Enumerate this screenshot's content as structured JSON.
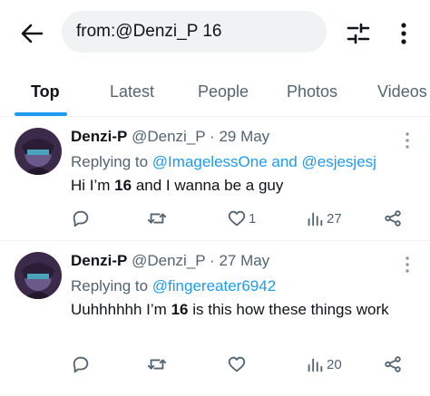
{
  "search": {
    "query": "from:@Denzi_P 16"
  },
  "tabs": [
    {
      "label": "Top"
    },
    {
      "label": "Latest"
    },
    {
      "label": "People"
    },
    {
      "label": "Photos"
    },
    {
      "label": "Videos"
    }
  ],
  "colors": {
    "accent": "#1d9bf0",
    "text": "#0f1419",
    "muted": "#536471",
    "divider": "#eff3f4"
  },
  "icons": [
    "back-arrow-icon",
    "filter-sliders-icon",
    "more-vertical-icon",
    "more-horizontal-icon",
    "reply-icon",
    "retweet-icon",
    "like-icon",
    "views-icon",
    "share-icon"
  ],
  "tweets": [
    {
      "name": "Denzi-P",
      "handle": "@Denzi_P",
      "sep": "·",
      "date": "29 May",
      "replying_prefix": "Replying to",
      "replying_to": "@ImagelessOne and @esjesjesj",
      "text_before": "Hi I’m ",
      "text_bold": "16",
      "text_after": " and I wanna be a guy",
      "likes": "1",
      "views": "27"
    },
    {
      "name": "Denzi-P",
      "handle": "@Denzi_P",
      "sep": "·",
      "date": "27 May",
      "replying_prefix": "Replying to",
      "replying_to": "@fingereater6942",
      "text_before": "Uuhhhhhh I’m ",
      "text_bold": "16",
      "text_after": " is this how these things work",
      "likes": "",
      "views": "20"
    }
  ]
}
